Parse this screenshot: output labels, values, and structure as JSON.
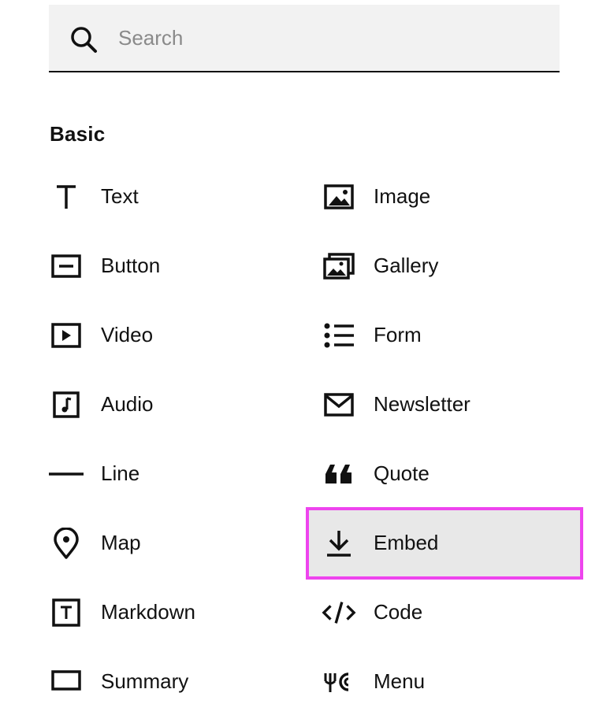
{
  "search": {
    "placeholder": "Search",
    "value": ""
  },
  "section": {
    "title": "Basic"
  },
  "blocks_left": [
    {
      "label": "Text",
      "icon": "text-icon"
    },
    {
      "label": "Button",
      "icon": "button-icon"
    },
    {
      "label": "Video",
      "icon": "video-icon"
    },
    {
      "label": "Audio",
      "icon": "audio-icon"
    },
    {
      "label": "Line",
      "icon": "line-icon"
    },
    {
      "label": "Map",
      "icon": "map-pin-icon"
    },
    {
      "label": "Markdown",
      "icon": "markdown-icon"
    },
    {
      "label": "Summary",
      "icon": "summary-icon"
    }
  ],
  "blocks_right": [
    {
      "label": "Image",
      "icon": "image-icon"
    },
    {
      "label": "Gallery",
      "icon": "gallery-icon"
    },
    {
      "label": "Form",
      "icon": "form-list-icon"
    },
    {
      "label": "Newsletter",
      "icon": "envelope-icon"
    },
    {
      "label": "Quote",
      "icon": "quote-icon"
    },
    {
      "label": "Embed",
      "icon": "download-icon",
      "highlighted": true
    },
    {
      "label": "Code",
      "icon": "code-icon"
    },
    {
      "label": "Menu",
      "icon": "menu-icon"
    }
  ],
  "colors": {
    "highlight_outline": "#ee44ee",
    "highlight_bg": "#e8e8e8",
    "search_bg": "#f2f2f2"
  }
}
